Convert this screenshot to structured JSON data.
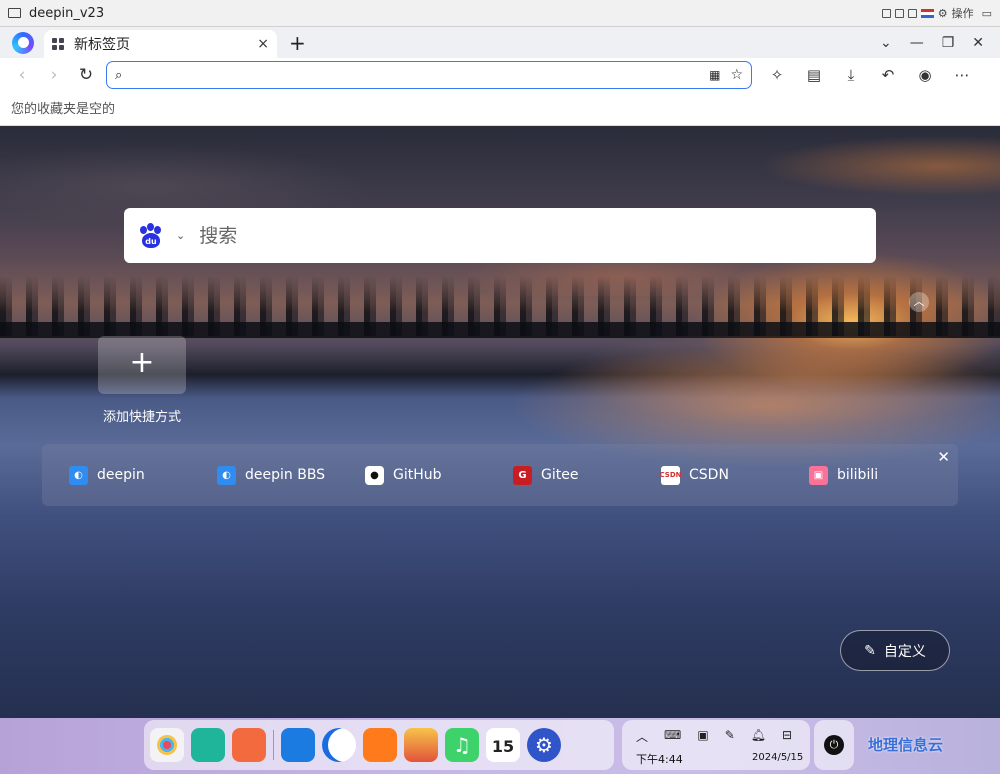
{
  "vm": {
    "title": "deepin_v23",
    "action_label": "操作"
  },
  "tab": {
    "label": "新标签页",
    "close": "×",
    "new": "+"
  },
  "window": {
    "dropdown": "⌄",
    "minimize": "—",
    "restore": "❐",
    "close": "✕"
  },
  "address": {
    "value": "",
    "placeholder": ""
  },
  "bookmarks": {
    "empty_text": "您的收藏夹是空的"
  },
  "newtab": {
    "search_placeholder": "搜索",
    "search_engine": "baidu",
    "add_shortcut_label": "添加快捷方式",
    "add_shortcut_glyph": "+",
    "collapse_glyph": "︿",
    "favorites": [
      {
        "label": "deepin",
        "color": "#2f8cf0",
        "glyph": "◐"
      },
      {
        "label": "deepin BBS",
        "color": "#2f8cf0",
        "glyph": "◐"
      },
      {
        "label": "GitHub",
        "color": "#ffffff",
        "glyph": "●"
      },
      {
        "label": "Gitee",
        "color": "#c71d23",
        "glyph": "G"
      },
      {
        "label": "CSDN",
        "color": "#ffffff",
        "glyph": "C"
      },
      {
        "label": "bilibili",
        "color": "#fb7299",
        "glyph": "▣"
      }
    ],
    "customize_label": "自定义"
  },
  "dock": {
    "apps": [
      {
        "name": "launcher",
        "color": "#f3f3f5"
      },
      {
        "name": "file-manager",
        "color": "#1fb59a"
      },
      {
        "name": "app-store",
        "color": "#f26a3d"
      },
      {
        "name": "notes",
        "color": "#1b7be0"
      },
      {
        "name": "browser",
        "color": "#ffffff"
      },
      {
        "name": "shop",
        "color": "#ff7a1a"
      },
      {
        "name": "image-viewer",
        "color": "#f2a33a"
      },
      {
        "name": "music",
        "color": "#3dd36a"
      },
      {
        "name": "calendar",
        "color": "#ffffff"
      },
      {
        "name": "settings",
        "color": "#2f55c8"
      }
    ],
    "calendar_day": "15",
    "time": "下午4:44",
    "date": "2024/5/15",
    "watermark": "地理信息云"
  }
}
